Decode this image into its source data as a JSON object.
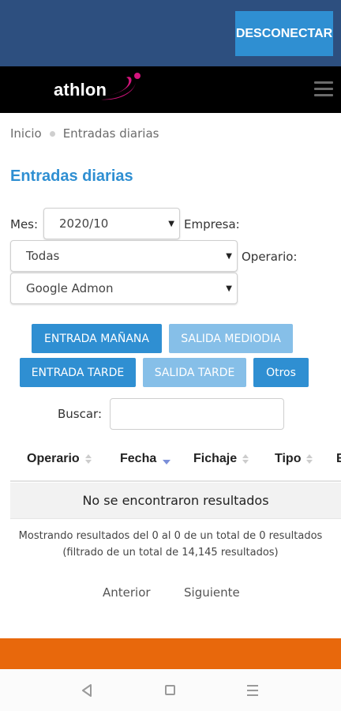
{
  "header": {
    "disconnect_label": "DESCONECTAR"
  },
  "brand": {
    "logo_text": "athlon",
    "logo_accent_color": "#d4147d"
  },
  "breadcrumb": {
    "home": "Inicio",
    "current": "Entradas diarias"
  },
  "page": {
    "title": "Entradas diarias"
  },
  "filters": {
    "mes_label": "Mes:",
    "mes_value": "2020/10",
    "empresa_label": "Empresa:",
    "empresa_value": "Todas",
    "operario_label": "Operario:",
    "operario_value": "Google Admon"
  },
  "buttons": {
    "entrada_manana": "ENTRADA MAÑANA",
    "salida_mediodia": "SALIDA MEDIODIA",
    "entrada_tarde": "ENTRADA TARDE",
    "salida_tarde": "SALIDA TARDE",
    "otros": "Otros"
  },
  "search": {
    "label": "Buscar:",
    "value": ""
  },
  "table": {
    "columns": [
      "Operario",
      "Fecha",
      "Fichaje",
      "Tipo",
      "E"
    ],
    "empty_message": "No se encontraron resultados"
  },
  "info": {
    "line1": "Mostrando resultados del 0 al 0 de un total de 0 resultados",
    "line2": "(filtrado de un total de 14,145 resultados)"
  },
  "pagination": {
    "prev": "Anterior",
    "next": "Siguiente"
  },
  "colors": {
    "accent": "#2f8fd2",
    "header": "#2d4f7f",
    "footer": "#e8680c"
  }
}
